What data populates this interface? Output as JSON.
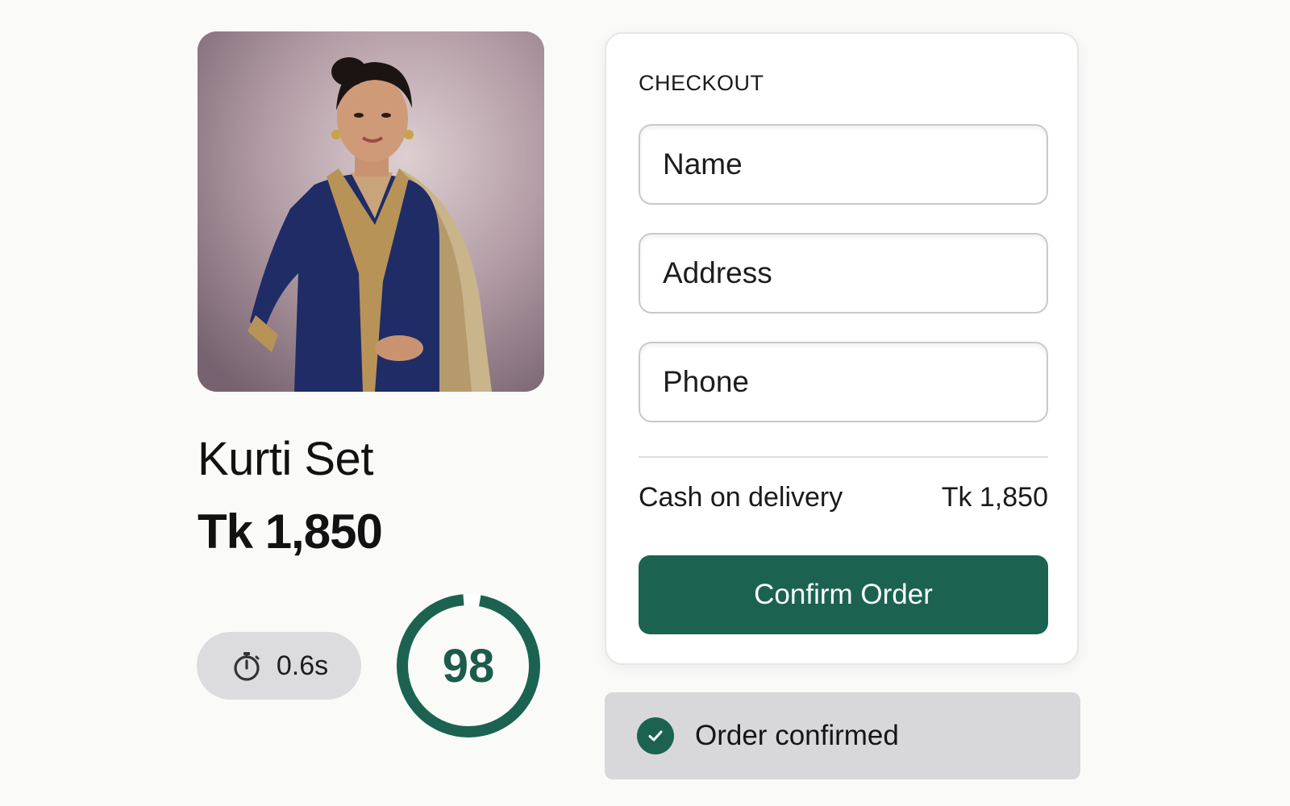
{
  "product": {
    "title": "Kurti Set",
    "price": "Tk 1,850",
    "image_description": "woman-in-navy-embroidered-kurti"
  },
  "metrics": {
    "load_time": "0.6s",
    "score": "98",
    "score_fraction": 0.96,
    "timer_icon": "stopwatch-icon"
  },
  "checkout": {
    "heading": "CHECKOUT",
    "fields": {
      "name_placeholder": "Name",
      "address_placeholder": "Address",
      "phone_placeholder": "Phone"
    },
    "payment_method": "Cash on delivery",
    "total": "Tk 1,850",
    "confirm_label": "Confirm Order"
  },
  "banner": {
    "text": "Order confirmed",
    "icon": "check-circle-icon"
  },
  "colors": {
    "accent": "#1b6350",
    "ring_track": "#ffffff",
    "pill_bg": "#dcdcde",
    "banner_bg": "#d8d8da"
  }
}
